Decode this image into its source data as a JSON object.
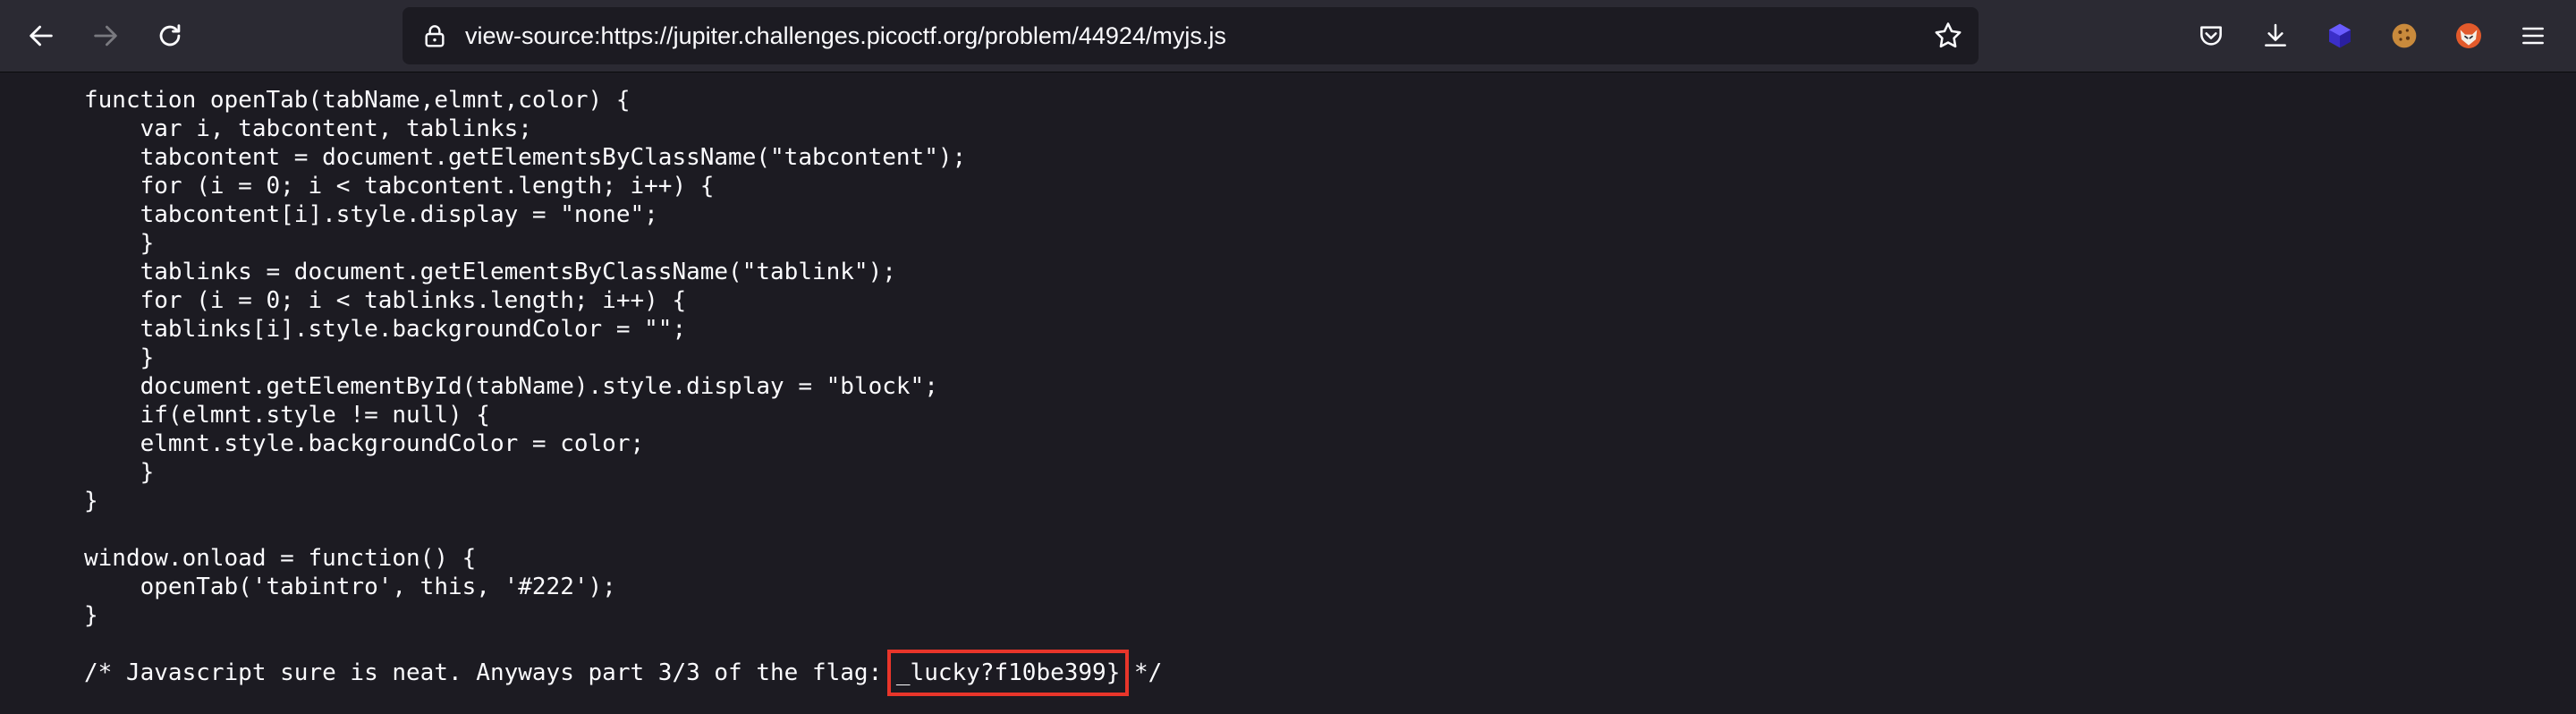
{
  "toolbar": {
    "back_icon": "arrow-left-icon",
    "forward_icon": "arrow-right-icon",
    "reload_icon": "reload-icon",
    "url": "view-source:https://jupiter.challenges.picoctf.org/problem/44924/myjs.js",
    "lock_icon": "lock-icon",
    "bookmark_icon": "star-icon",
    "pocket_icon": "pocket-icon",
    "downloads_icon": "download-icon",
    "extensions": [
      "cube-extension-icon",
      "cookie-extension-icon",
      "fox-extension-icon"
    ],
    "menu_icon": "hamburger-menu-icon"
  },
  "source": {
    "lines": [
      "function openTab(tabName,elmnt,color) {",
      "    var i, tabcontent, tablinks;",
      "    tabcontent = document.getElementsByClassName(\"tabcontent\");",
      "    for (i = 0; i < tabcontent.length; i++) {",
      "    tabcontent[i].style.display = \"none\";",
      "    }",
      "    tablinks = document.getElementsByClassName(\"tablink\");",
      "    for (i = 0; i < tablinks.length; i++) {",
      "    tablinks[i].style.backgroundColor = \"\";",
      "    }",
      "    document.getElementById(tabName).style.display = \"block\";",
      "    if(elmnt.style != null) {",
      "    elmnt.style.backgroundColor = color;",
      "    }",
      "}",
      "",
      "window.onload = function() {",
      "    openTab('tabintro', this, '#222');",
      "}",
      ""
    ],
    "comment_prefix": "/* Javascript sure is neat. Anyways part 3/3 of the flag: ",
    "flag_part": "_lucky?f10be399}",
    "comment_suffix": " */"
  },
  "colors": {
    "background": "#1c1b22",
    "toolbar": "#2b2a33",
    "text": "#fbfbfe",
    "highlight": "#e8352a"
  }
}
